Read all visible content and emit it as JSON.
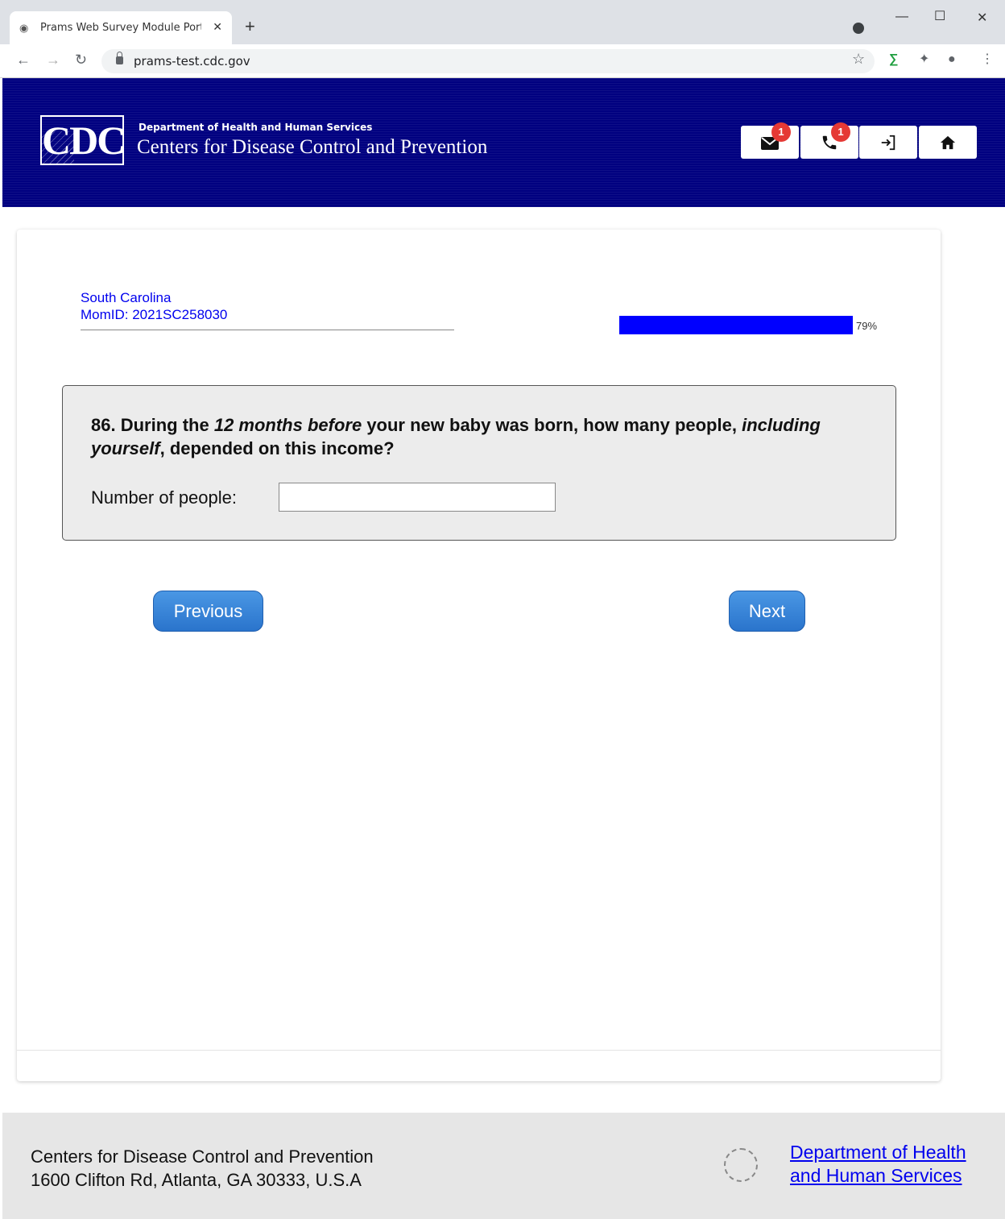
{
  "browser": {
    "tab_title": "Prams Web Survey Module Porta",
    "url": "prams-test.cdc.gov"
  },
  "header": {
    "logo_text": "CDC",
    "dept_small": "Department of Health and Human Services",
    "org_name": "Centers for Disease Control and Prevention",
    "mail_badge": "1",
    "phone_badge": "1"
  },
  "respondent": {
    "state": "South Carolina",
    "momid": "MomID: 2021SC258030"
  },
  "progress": {
    "percent": 79,
    "label": "79%"
  },
  "question": {
    "number": "86.",
    "text_part1": "During the ",
    "text_italic1": "12 months before",
    "text_part2": " your new baby was born, how many people, ",
    "text_italic2": "including yourself",
    "text_part3": ", depended on this income?",
    "input_label": "Number of people:",
    "input_value": ""
  },
  "nav": {
    "previous_label": "Previous",
    "next_label": "Next"
  },
  "footer": {
    "org": "Centers for Disease Control and Prevention",
    "address": "1600 Clifton Rd, Atlanta, GA 30333, U.S.A",
    "hhs_line1": "Department of Health",
    "hhs_line2": "and Human Services"
  }
}
